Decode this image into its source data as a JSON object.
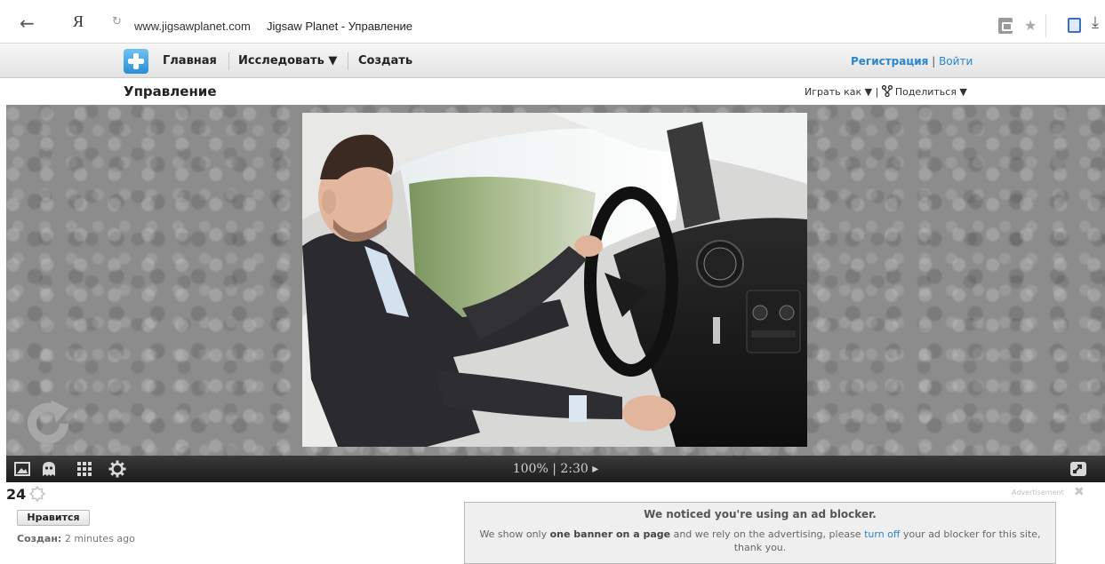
{
  "browser": {
    "back_glyph": "←",
    "search_logo": "Я",
    "reload_glyph": "↻",
    "url_domain": "www.jigsawplanet.com",
    "page_title": "Jigsaw Planet - Управление",
    "star_glyph": "★",
    "download_glyph": "⤓"
  },
  "site_nav": {
    "logo_icon": "puzzle-logo",
    "items": [
      {
        "label": "Главная"
      },
      {
        "label": "Исследовать ▼"
      },
      {
        "label": "Создать"
      }
    ],
    "register_label": "Регистрация",
    "separator": "|",
    "login_label": "Войти"
  },
  "page_header": {
    "title": "Управление",
    "play_as_label": "Играть как ▼",
    "separator": "|",
    "share_label": "Поделиться ▼"
  },
  "puzzle": {
    "image_icon": "puzzle-photo",
    "progress": "100% | 2:30 ▸"
  },
  "controls": {
    "icons": [
      "image-preview-icon",
      "ghost-icon",
      "pieces-grid-icon",
      "settings-gear-icon",
      "fullscreen-icon"
    ]
  },
  "stats": {
    "likes_count": "24",
    "like_button": "Нравится",
    "created_label": "Создан:",
    "created_value": "2 minutes ago"
  },
  "ad": {
    "label": "Advertisement",
    "close_glyph": "✖",
    "title": "We noticed you're using an ad blocker.",
    "body_prefix": "We show only ",
    "body_bold": "one banner on a page",
    "body_mid": " and we rely on the advertising, please ",
    "body_link": "turn off",
    "body_suffix": " your ad blocker for this site, thank you."
  },
  "colors": {
    "accent_link": "#2a86cf",
    "control_bar": "#262626",
    "stage_bg": "#8c8c8c"
  }
}
